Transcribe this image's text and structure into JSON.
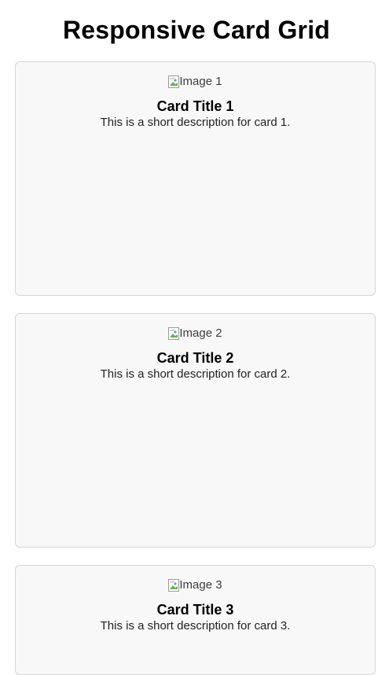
{
  "page": {
    "title": "Responsive Card Grid"
  },
  "cards": [
    {
      "image_alt": "Image 1",
      "title": "Card Title 1",
      "description": "This is a short description for card 1."
    },
    {
      "image_alt": "Image 2",
      "title": "Card Title 2",
      "description": "This is a short description for card 2."
    },
    {
      "image_alt": "Image 3",
      "title": "Card Title 3",
      "description": "This is a short description for card 3."
    }
  ],
  "icons": {
    "card_image": "broken-image-icon"
  },
  "colors": {
    "card_background": "#f8f8f8",
    "card_border": "#d6d6d6",
    "page_background": "#ffffff",
    "text": "#000000"
  }
}
